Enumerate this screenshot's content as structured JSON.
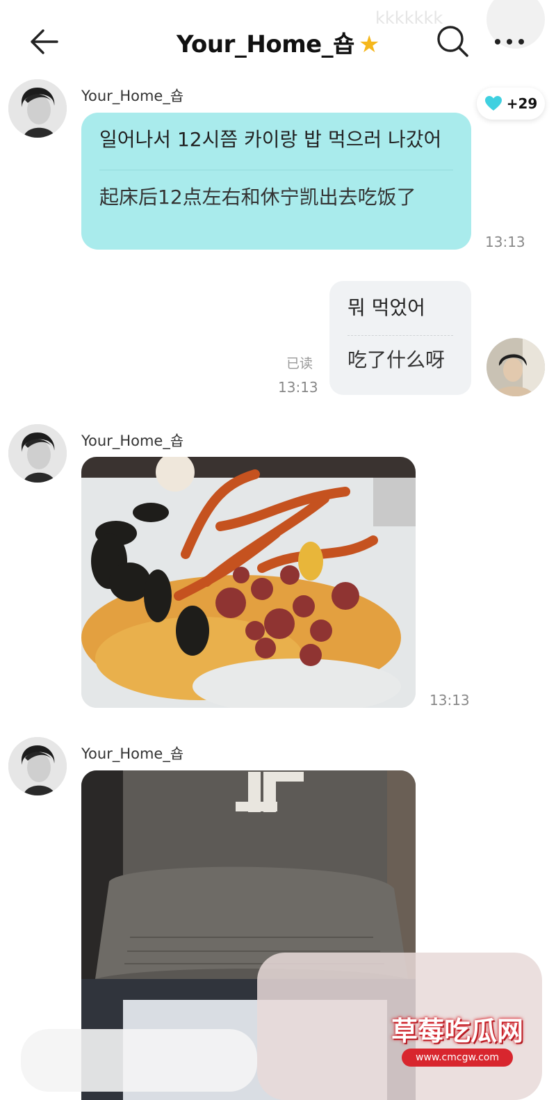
{
  "header": {
    "title": "Your_Home_숍",
    "star_icon": "star-emoji",
    "ghost_text": "kkkkkkk"
  },
  "like_badge": {
    "count": "+29",
    "icon": "heart-icon",
    "color": "#3fd0e0"
  },
  "messages": [
    {
      "sender": "Your_Home_숍",
      "text_ko": "일어나서 12시쯤 카이랑 밥 먹으러 나갔어",
      "text_zh": "起床后12点左右和休宁凯出去吃饭了",
      "time": "13:13"
    },
    {
      "text_ko": "뭐 먹었어",
      "text_zh": "吃了什么呀",
      "read_status": "已读",
      "time": "13:13"
    },
    {
      "sender": "Your_Home_숍",
      "image": "seafood-boil-photo",
      "time": "13:13"
    },
    {
      "sender": "Your_Home_숍",
      "image": "baseball-cap-photo"
    }
  ],
  "watermark": {
    "title": "草莓吃瓜网",
    "url": "www.cmcgw.com"
  },
  "colors": {
    "incoming_bubble": "#a9ebec",
    "outgoing_bubble": "#f0f2f4",
    "accent_red": "#d8262e"
  }
}
